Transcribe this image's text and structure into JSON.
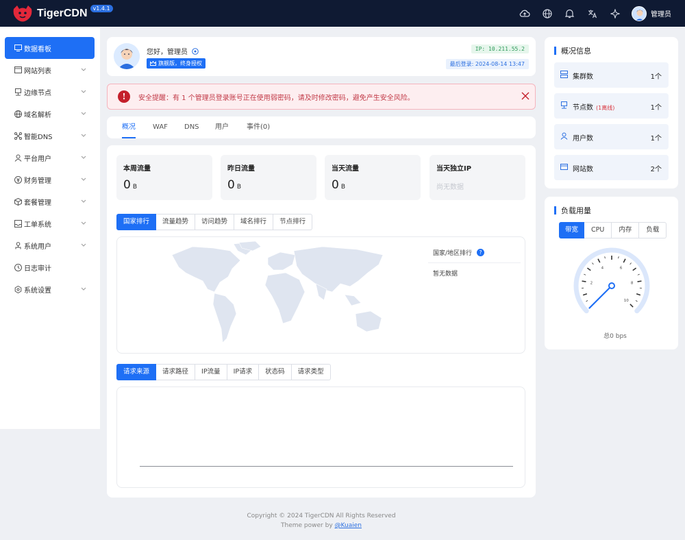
{
  "app": {
    "name": "TigerCDN",
    "version": "v1.4.1"
  },
  "header": {
    "icons": [
      "cloud-upload-icon",
      "globe-icon",
      "bell-icon",
      "translate-icon",
      "theme-icon"
    ],
    "user_name": "管理员"
  },
  "sidebar": {
    "items": [
      {
        "label": "数据看板",
        "icon": "dashboard-icon",
        "active": true
      },
      {
        "label": "网站列表",
        "icon": "website-icon"
      },
      {
        "label": "边缘节点",
        "icon": "node-icon"
      },
      {
        "label": "域名解析",
        "icon": "globe-icon"
      },
      {
        "label": "智能DNS",
        "icon": "dns-icon"
      },
      {
        "label": "平台用户",
        "icon": "user-icon"
      },
      {
        "label": "财务管理",
        "icon": "finance-icon"
      },
      {
        "label": "套餐管理",
        "icon": "package-icon"
      },
      {
        "label": "工单系统",
        "icon": "ticket-icon"
      },
      {
        "label": "系统用户",
        "icon": "admin-icon"
      },
      {
        "label": "日志审计",
        "icon": "log-icon"
      },
      {
        "label": "系统设置",
        "icon": "settings-icon"
      }
    ]
  },
  "welcome": {
    "greeting": "您好，管理员",
    "license": "旗舰版，终身授权",
    "ip": "IP: 10.211.55.2",
    "last_login": "最后登录: 2024-08-14 13:47"
  },
  "alert": {
    "text": "安全提醒：有 1 个管理员登录账号正在使用弱密码，请及时修改密码，避免产生安全风险。"
  },
  "tabs": [
    {
      "label": "概况",
      "active": true
    },
    {
      "label": "WAF"
    },
    {
      "label": "DNS"
    },
    {
      "label": "用户"
    },
    {
      "label": "事件(0)"
    }
  ],
  "stats": [
    {
      "title": "本周流量",
      "value": "0",
      "unit": "B"
    },
    {
      "title": "昨日流量",
      "value": "0",
      "unit": "B"
    },
    {
      "title": "当天流量",
      "value": "0",
      "unit": "B"
    },
    {
      "title": "当天独立IP",
      "empty": "尚无数据"
    }
  ],
  "rank_tabs": [
    "国家排行",
    "流量趋势",
    "访问趋势",
    "域名排行",
    "节点排行"
  ],
  "rank_panel": {
    "header": "国家/地区排行",
    "empty": "暂无数据"
  },
  "req_tabs": [
    "请求来源",
    "请求路径",
    "IP流量",
    "IP请求",
    "状态码",
    "请求类型"
  ],
  "overview": {
    "title": "概况信息",
    "items": [
      {
        "label": "集群数",
        "value": "1个",
        "icon": "cluster-icon"
      },
      {
        "label": "节点数",
        "extra": "(1离线)",
        "value": "1个",
        "icon": "server-icon"
      },
      {
        "label": "用户数",
        "value": "1个",
        "icon": "users-icon"
      },
      {
        "label": "网站数",
        "value": "2个",
        "icon": "website-icon"
      }
    ]
  },
  "load": {
    "title": "负载用量",
    "tabs": [
      "带宽",
      "CPU",
      "内存",
      "负载"
    ],
    "gauge_ticks": [
      "2",
      "4",
      "6",
      "8",
      "10"
    ],
    "gauge_value": 0,
    "caption": "总0 bps"
  },
  "footer": {
    "copyright": "Copyright © 2024 TigerCDN All Rights Reserved",
    "powered_prefix": "Theme power by",
    "powered_link": "@Kuaien"
  },
  "colors": {
    "primary": "#1e6ff5",
    "topbar": "#0f1a33",
    "danger": "#c4202c"
  }
}
